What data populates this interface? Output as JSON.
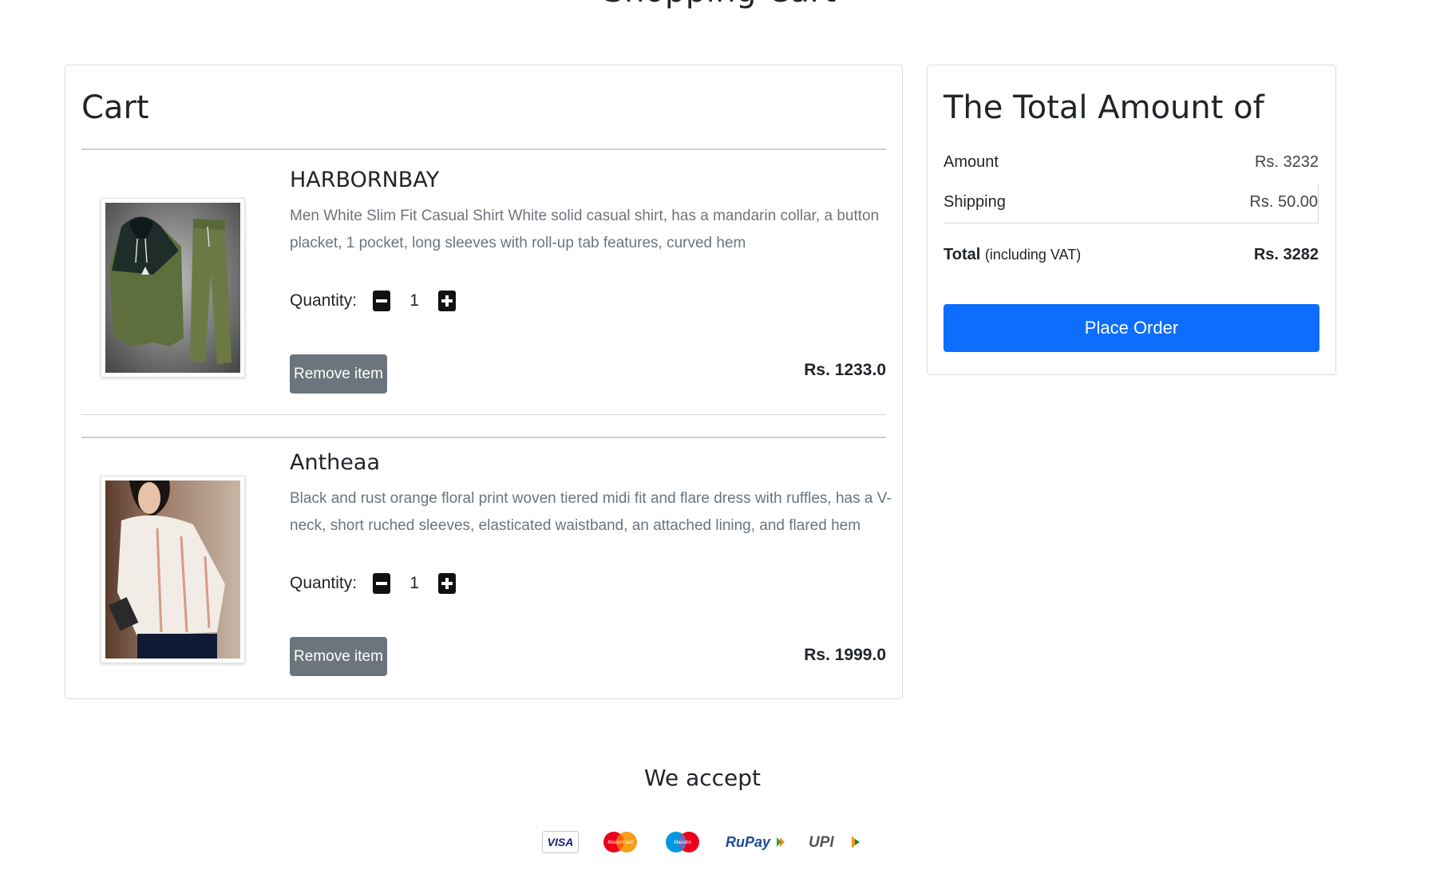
{
  "page": {
    "heading": "Shopping Cart"
  },
  "cart": {
    "title": "Cart",
    "items": [
      {
        "name": "HARBORNBAY",
        "description": "Men White Slim Fit Casual Shirt White solid casual shirt, has a mandarin collar, a button placket, 1 pocket, long sleeves with roll-up tab features, curved hem",
        "quantity_label": "Quantity:",
        "quantity": "1",
        "remove_label": "Remove item",
        "price": "Rs. 1233.0",
        "image": "tracksuit-photo"
      },
      {
        "name": "Antheaa",
        "description": "Black and rust orange floral print woven tiered midi fit and flare dress with ruffles, has a V-neck, short ruched sleeves, elasticated waistband, an attached lining, and flared hem",
        "quantity_label": "Quantity:",
        "quantity": "1",
        "remove_label": "Remove item",
        "price": "Rs. 1999.0",
        "image": "blouse-photo"
      }
    ]
  },
  "summary": {
    "title": "The Total Amount of",
    "amount_label": "Amount",
    "amount_value": "Rs. 3232",
    "shipping_label": "Shipping",
    "shipping_value": "Rs. 50.00",
    "total_label": "Total",
    "total_note": "(including VAT)",
    "total_value": "Rs. 3282",
    "place_order_label": "Place Order"
  },
  "payment": {
    "title": "We accept",
    "methods": [
      "VISA",
      "MasterCard",
      "Maestro",
      "RuPay",
      "UPI"
    ]
  },
  "colors": {
    "primary": "#0d6efd",
    "secondary": "#6c757d"
  }
}
